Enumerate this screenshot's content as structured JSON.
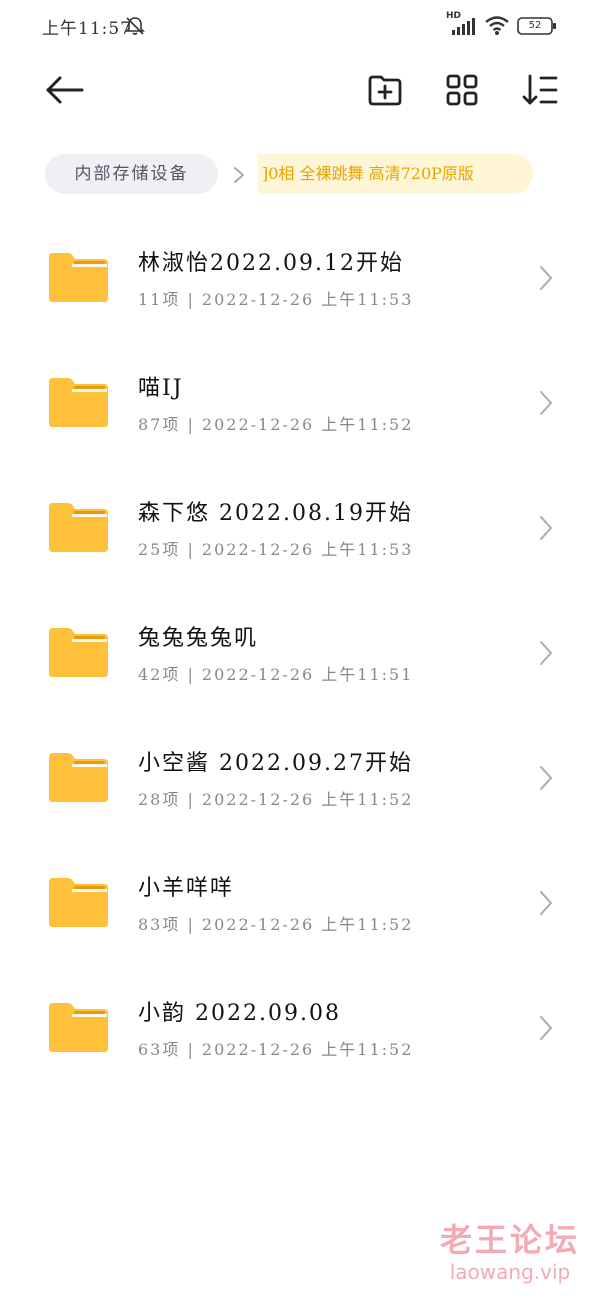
{
  "status_bar": {
    "time": "上午11:57",
    "network_badge": "HD",
    "battery_level": "52",
    "icons": [
      "do-not-disturb-off-icon",
      "signal-icon",
      "wifi-icon",
      "battery-icon"
    ]
  },
  "toolbar": {
    "icons": [
      "back-arrow-icon",
      "new-folder-icon",
      "grid-view-icon",
      "sort-icon"
    ]
  },
  "breadcrumb": {
    "root": "内部存储设备",
    "current": "]0相 全裸跳舞 高清720P原版"
  },
  "items": [
    {
      "name": "林淑怡2022.09.12开始",
      "meta": "11项 | 2022-12-26 上午11:53"
    },
    {
      "name": "喵IJ",
      "meta": "87项 | 2022-12-26 上午11:52"
    },
    {
      "name": "森下悠 2022.08.19开始",
      "meta": "25项 | 2022-12-26 上午11:53"
    },
    {
      "name": "兔兔兔兔叽",
      "meta": "42项 | 2022-12-26 上午11:51"
    },
    {
      "name": "小空酱 2022.09.27开始",
      "meta": "28项 | 2022-12-26 上午11:52"
    },
    {
      "name": "小羊咩咩",
      "meta": "83项 | 2022-12-26 上午11:52"
    },
    {
      "name": "小韵 2022.09.08",
      "meta": "63项 | 2022-12-26 上午11:52"
    }
  ],
  "watermark": {
    "title": "老王论坛",
    "url": "laowang.vip"
  },
  "colors": {
    "folder": "#FFC13A",
    "folder_dark": "#F4A917",
    "breadcrumb_current_bg": "#FFF6D8",
    "breadcrumb_current_text": "#E5A400",
    "breadcrumb_root_bg": "#EEF0F3",
    "watermark": "#F4AAB5"
  }
}
